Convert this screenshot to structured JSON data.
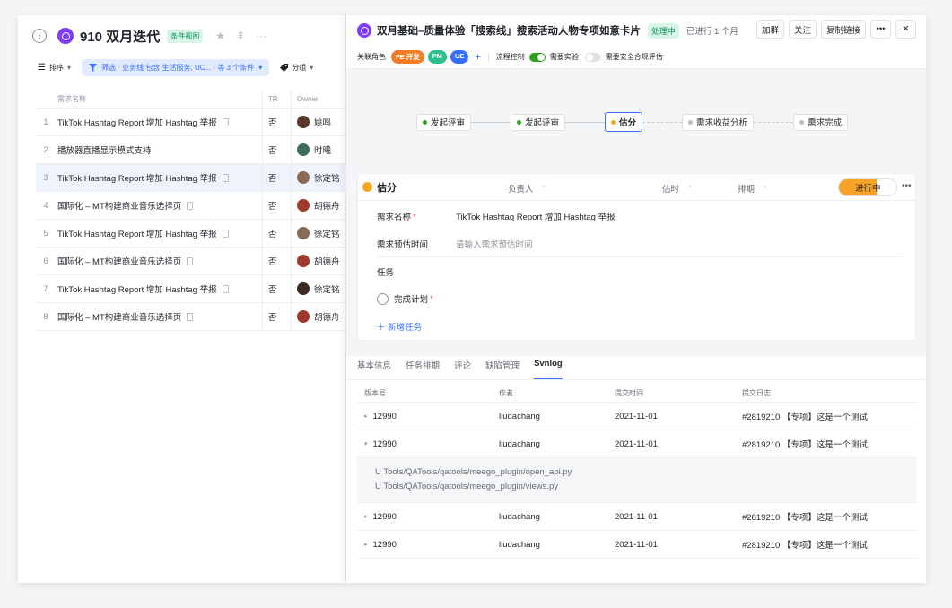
{
  "left": {
    "back_glyph": "‹",
    "title": "910 双月迭代",
    "view_tag": "条件视图",
    "star_glyph": "★",
    "pin_glyph": "⇞",
    "more_glyph": "···",
    "sort_label": "排序",
    "filter_label": "筛选 · 业务线 包含 生活服务, UC... · 等 3 个条件",
    "group_label": "分组",
    "caret": "▾",
    "columns": {
      "name": "需求名称",
      "tr": "TR",
      "owner": "Owner"
    },
    "rows": [
      {
        "idx": "1",
        "name": "TikTok Hashtag Report 增加 Hashtag 举报",
        "tr": "否",
        "owner": "姚鸣",
        "color": "#5b3a2e"
      },
      {
        "idx": "2",
        "name": "播放器直播显示模式支持",
        "tr": "否",
        "owner": "时曦",
        "color": "#3f6e5a"
      },
      {
        "idx": "3",
        "name": "TikTok Hashtag Report 增加 Hashtag 举报",
        "tr": "否",
        "owner": "徐定铭",
        "color": "#8a6a55"
      },
      {
        "idx": "4",
        "name": "国际化 – MT构建商业音乐选择页",
        "tr": "否",
        "owner": "胡德舟",
        "color": "#9e3b2d"
      },
      {
        "idx": "5",
        "name": "TikTok Hashtag Report 增加 Hashtag 举报",
        "tr": "否",
        "owner": "徐定铭",
        "color": "#8a6a55"
      },
      {
        "idx": "6",
        "name": "国际化 – MT构建商业音乐选择页",
        "tr": "否",
        "owner": "胡德舟",
        "color": "#9e3b2d"
      },
      {
        "idx": "7",
        "name": "TikTok Hashtag Report 增加 Hashtag 举报",
        "tr": "否",
        "owner": "徐定铭",
        "color": "#3b2a22"
      },
      {
        "idx": "8",
        "name": "国际化 – MT构建商业音乐选择页",
        "tr": "否",
        "owner": "胡德舟",
        "color": "#9e3b2d"
      }
    ]
  },
  "detail": {
    "title": "双月基础–质量体验「搜索线」搜索活动人物专项如意卡片",
    "status": "处理中",
    "since": "已进行 1 个月",
    "btn_group": "加群",
    "btn_follow": "关注",
    "btn_copy": "复制链接",
    "btn_more": "•••",
    "btn_close": "✕",
    "roles_label": "关联角色",
    "roles": [
      {
        "label": "FE 开发",
        "color": "#f77a24"
      },
      {
        "label": "PM",
        "color": "#2dbf8c"
      },
      {
        "label": "UE",
        "color": "#3370ff"
      }
    ],
    "add_role": "+",
    "flow_control": "流程控制",
    "need_experiment": "需要实验",
    "need_security": "需要安全合规评估",
    "flow": [
      {
        "label": "发起评审",
        "color": "#2ea121"
      },
      {
        "label": "发起评审",
        "color": "#2ea121"
      },
      {
        "label": "估分",
        "color": "#f5a623"
      },
      {
        "label": "需求收益分析",
        "color": "#bbbfc4"
      },
      {
        "label": "需求完成",
        "color": "#bbbfc4"
      }
    ],
    "panel": {
      "title": "估分",
      "owner_label": "负责人",
      "owner_value": "-",
      "estimate_label": "估时",
      "estimate_value": "-",
      "schedule_label": "排期",
      "schedule_value": "-",
      "status_btn": "进行中",
      "more": "•••",
      "field_name_label": "需求名称",
      "required_mark": "*",
      "field_name_value": "TikTok Hashtag Report 增加 Hashtag 举报",
      "field_time_label": "需求预估时间",
      "field_time_placeholder": "请输入需求预估时间",
      "task_label": "任务",
      "task_item": "完成计划",
      "add_task": "＋  新增任务"
    },
    "tabs": [
      "基本信息",
      "任务排期",
      "评论",
      "缺陷管理",
      "Svnlog"
    ],
    "svn": {
      "columns": [
        "版本号",
        "作者",
        "提交时间",
        "提交日志"
      ],
      "rows": [
        {
          "arrow": "▸",
          "version": "12990",
          "author": "liudachang",
          "time": "2021-11-01",
          "log": "#2819210 【专项】这是一个测试"
        },
        {
          "arrow": "▾",
          "version": "12990",
          "author": "liudachang",
          "time": "2021-11-01",
          "log": "#2819210 【专项】这是一个测试"
        },
        {
          "arrow": "▸",
          "version": "12990",
          "author": "liudachang",
          "time": "2021-11-01",
          "log": "#2819210 【专项】这是一个测试"
        },
        {
          "arrow": "▸",
          "version": "12990",
          "author": "liudachang",
          "time": "2021-11-01",
          "log": "#2819210 【专项】这是一个测试"
        }
      ],
      "expanded_files": [
        "U Tools/QATools/qatools/meego_plugin/open_api.py",
        "U Tools/QATools/qatools/meego_plugin/views.py"
      ]
    }
  }
}
